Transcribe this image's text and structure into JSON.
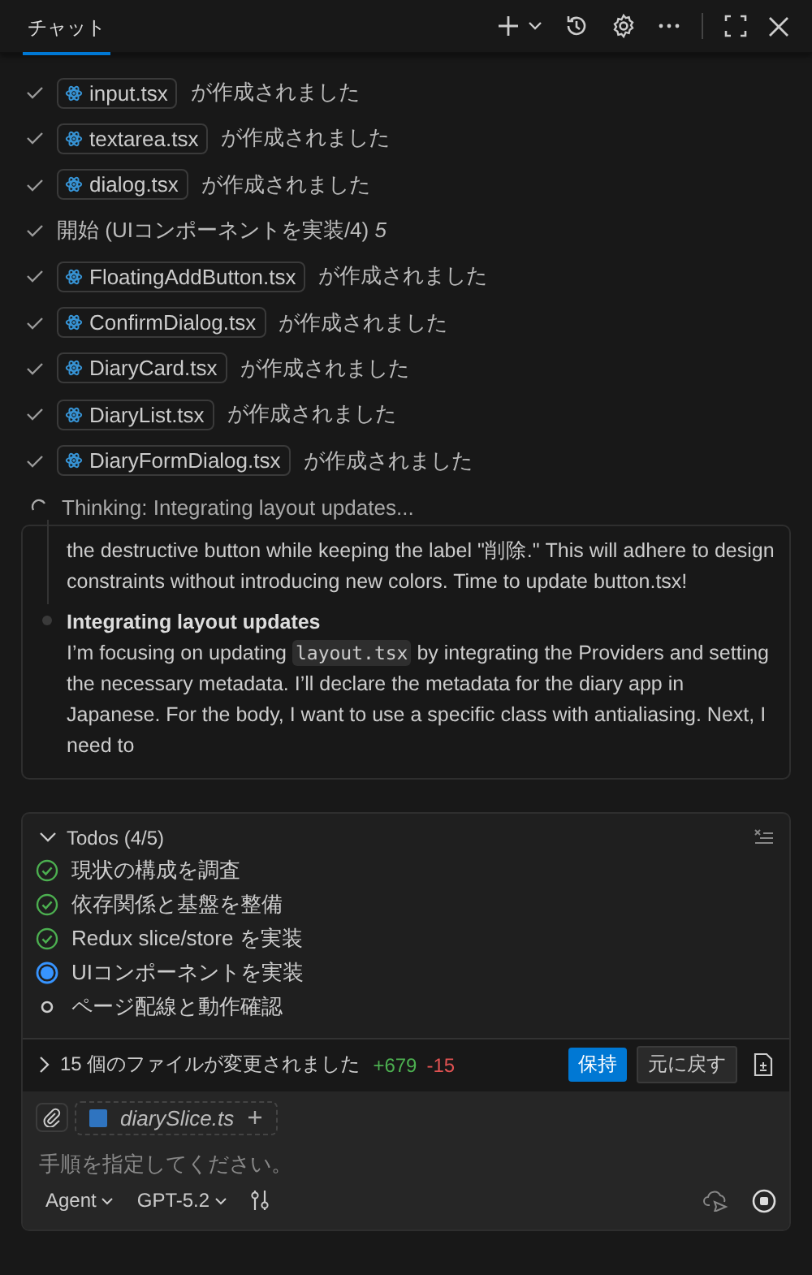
{
  "tabs": [
    {
      "label": "チャット",
      "selected": true
    }
  ],
  "progress": [
    {
      "kind": "file",
      "file": "input.tsx",
      "text": "が作成されました"
    },
    {
      "kind": "file",
      "file": "textarea.tsx",
      "text": "が作成されました"
    },
    {
      "kind": "file",
      "file": "dialog.tsx",
      "text": "が作成されました"
    },
    {
      "kind": "step",
      "text": "開始 (UIコンポーネントを実装/4) *5*"
    },
    {
      "kind": "file",
      "file": "FloatingAddButton.tsx",
      "text": "が作成されました"
    },
    {
      "kind": "file",
      "file": "ConfirmDialog.tsx",
      "text": "が作成されました"
    },
    {
      "kind": "file",
      "file": "DiaryCard.tsx",
      "text": "が作成されました"
    },
    {
      "kind": "file",
      "file": "DiaryList.tsx",
      "text": "が作成されました"
    },
    {
      "kind": "file",
      "file": "DiaryFormDialog.tsx",
      "text": "が作成されました"
    }
  ],
  "thinking": {
    "status": "Thinking: Integrating layout updates...",
    "paragraphs": [
      {
        "parts": [
          {
            "kind": "text",
            "text": "the destructive button while keeping the label \"削除.\" This will adhere to design constraints without introducing new colors. Time to update button.tsx!"
          }
        ]
      },
      {
        "heading": "Integrating layout updates",
        "parts": [
          {
            "kind": "text",
            "text": "I’m focusing on updating "
          },
          {
            "kind": "code",
            "text": "layout.tsx"
          },
          {
            "kind": "text",
            "text": " by integrating the Providers and setting the necessary metadata. I’ll declare the metadata for the diary app in Japanese. For the body, I want to use a specific class with antialiasing. Next, I need to"
          }
        ]
      }
    ]
  },
  "todos": {
    "title": "Todos (4/5)",
    "expanded": true,
    "items": [
      {
        "text": "現状の構成を調査",
        "kind": "done"
      },
      {
        "text": "依存関係と基盤を整備",
        "kind": "done"
      },
      {
        "text": "Redux slice/store を実装",
        "kind": "done"
      },
      {
        "text": "UIコンポーネントを実装",
        "kind": "active"
      },
      {
        "text": "ページ配線と動作確認",
        "kind": "pending"
      }
    ]
  },
  "changes": {
    "text": "15 個のファイルが変更されました",
    "added": "+679",
    "removed": "-15",
    "expanded": false,
    "keep": "保持",
    "undo": "元に戻す"
  },
  "composer": {
    "attachment": "diarySlice.ts",
    "placeholder": "手順を指定してください。",
    "mode": "Agent",
    "model": "GPT-5.2"
  }
}
